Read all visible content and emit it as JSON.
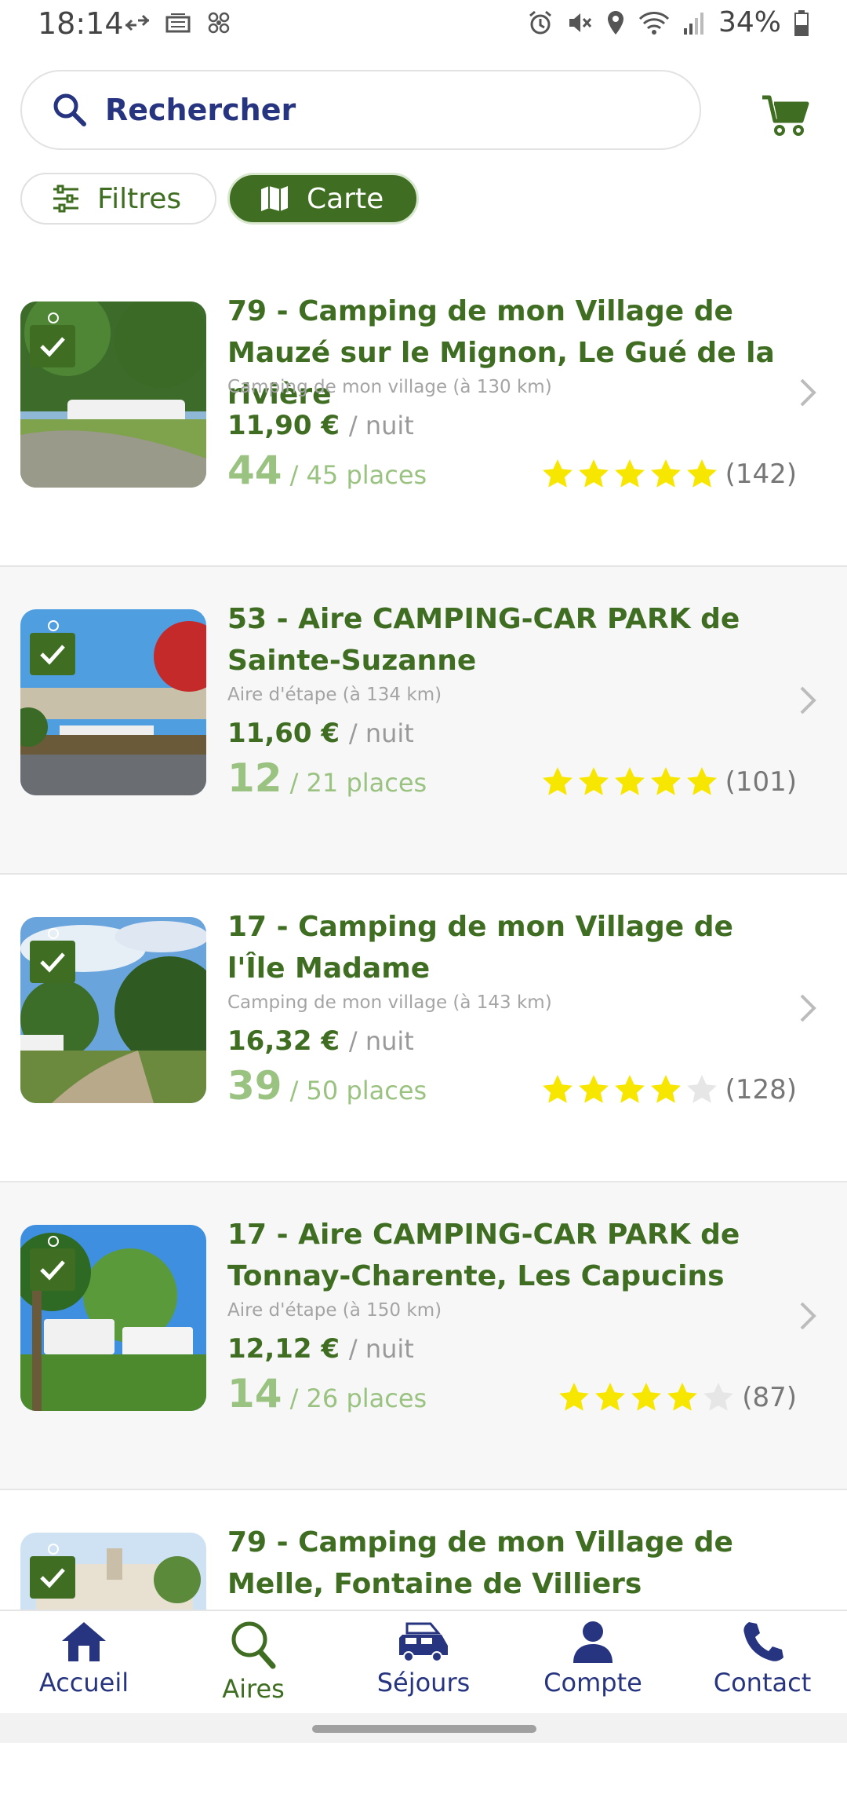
{
  "status_bar": {
    "time": "18:14",
    "battery": "34%",
    "icons": [
      "data-saver-icon",
      "nfc-icon",
      "fan-icon",
      "alarm-icon",
      "mute-icon",
      "location-icon",
      "wifi-icon",
      "signal-icon",
      "battery-icon"
    ]
  },
  "search": {
    "placeholder": "Rechercher"
  },
  "chips": {
    "filters_label": "Filtres",
    "map_label": "Carte"
  },
  "colors": {
    "primary_green": "#3f6e22",
    "light_green": "#9ac281",
    "nav_blue": "#273580",
    "star_yellow": "#f7e600"
  },
  "listings": [
    {
      "title": "79 - Camping de mon Village de Mauzé sur le Mignon, Le Gué de la rivière",
      "subtitle": "Camping de mon village (à 130 km)",
      "price": "11,90 €",
      "unit": "/ nuit",
      "places_free": "44",
      "places_total": "/ 45 places",
      "rating": 5,
      "reviews": "(142)"
    },
    {
      "title": "53 - Aire CAMPING-CAR PARK de Sainte-Suzanne",
      "subtitle": "Aire d'étape (à 134 km)",
      "price": "11,60 €",
      "unit": "/ nuit",
      "places_free": "12",
      "places_total": "/ 21 places",
      "rating": 5,
      "reviews": "(101)"
    },
    {
      "title": "17 - Camping de mon Village de l'Île Madame",
      "subtitle": "Camping de mon village (à 143 km)",
      "price": "16,32 €",
      "unit": "/ nuit",
      "places_free": "39",
      "places_total": "/ 50 places",
      "rating": 4,
      "reviews": "(128)"
    },
    {
      "title": "17 - Aire CAMPING-CAR PARK de Tonnay-Charente, Les Capucins",
      "subtitle": "Aire d'étape (à 150 km)",
      "price": "12,12 €",
      "unit": "/ nuit",
      "places_free": "14",
      "places_total": "/ 26 places",
      "rating": 4,
      "reviews": "(87)"
    },
    {
      "title": "79 - Camping de mon Village de Melle, Fontaine de Villiers"
    }
  ],
  "bottom_nav": [
    {
      "label": "Accueil",
      "icon": "home-icon",
      "active": false
    },
    {
      "label": "Aires",
      "icon": "search-icon",
      "active": true
    },
    {
      "label": "Séjours",
      "icon": "van-icon",
      "active": false
    },
    {
      "label": "Compte",
      "icon": "user-icon",
      "active": false
    },
    {
      "label": "Contact",
      "icon": "phone-icon",
      "active": false
    }
  ]
}
